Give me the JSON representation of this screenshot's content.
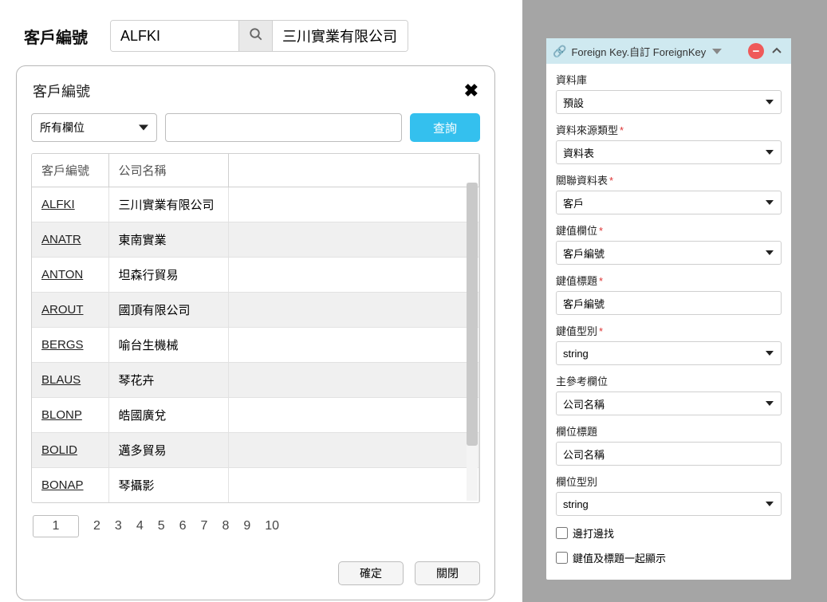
{
  "top": {
    "label": "客戶編號",
    "code_value": "ALFKI",
    "readonly_value": "三川實業有限公司"
  },
  "dialog": {
    "title": "客戶編號",
    "filter_field": "所有欄位",
    "filter_text": "",
    "query_btn": "查詢",
    "columns": [
      "客戶編號",
      "公司名稱"
    ],
    "rows": [
      {
        "code": "ALFKI",
        "name": "三川實業有限公司"
      },
      {
        "code": "ANATR",
        "name": "東南實業"
      },
      {
        "code": "ANTON",
        "name": "坦森行貿易"
      },
      {
        "code": "AROUT",
        "name": "國頂有限公司"
      },
      {
        "code": "BERGS",
        "name": "喻台生機械"
      },
      {
        "code": "BLAUS",
        "name": "琴花卉"
      },
      {
        "code": "BLONP",
        "name": "皓國廣兌"
      },
      {
        "code": "BOLID",
        "name": "邁多貿易"
      },
      {
        "code": "BONAP",
        "name": "琴攝影"
      }
    ],
    "pages": [
      "1",
      "2",
      "3",
      "4",
      "5",
      "6",
      "7",
      "8",
      "9",
      "10"
    ],
    "current_page": "1",
    "ok_btn": "確定",
    "close_btn": "關閉"
  },
  "panel": {
    "title": "Foreign Key.自訂 ForeignKey",
    "fields": {
      "db": {
        "label": "資料庫",
        "value": "預設",
        "required": false
      },
      "source_type": {
        "label": "資料來源類型",
        "value": "資料表",
        "required": true
      },
      "rel_table": {
        "label": "關聯資料表",
        "value": "客戶",
        "required": true
      },
      "key_col": {
        "label": "鍵值欄位",
        "value": "客戶編號",
        "required": true
      },
      "key_title": {
        "label": "鍵值標題",
        "value": "客戶編號",
        "required": true,
        "type": "input"
      },
      "key_type": {
        "label": "鍵值型別",
        "value": "string",
        "required": true
      },
      "ref_col": {
        "label": "主參考欄位",
        "value": "公司名稱",
        "required": false
      },
      "col_title": {
        "label": "欄位標題",
        "value": "公司名稱",
        "required": false,
        "type": "input"
      },
      "col_type": {
        "label": "欄位型別",
        "value": "string",
        "required": false
      }
    },
    "checks": {
      "incremental": {
        "label": "邊打邊找",
        "checked": false
      },
      "show_both": {
        "label": "鍵值及標題一起顯示",
        "checked": false
      }
    }
  }
}
